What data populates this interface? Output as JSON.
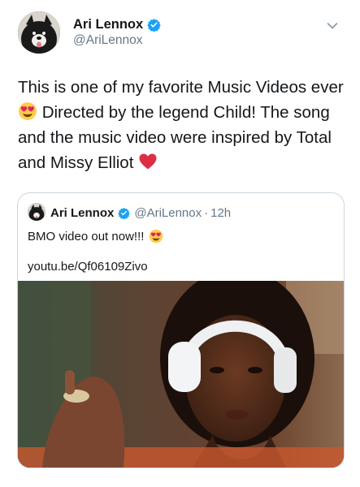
{
  "tweet": {
    "author_name": "Ari Lennox",
    "author_handle": "@AriLennox",
    "text_part1": "This is one of my favorite Music Videos ever",
    "text_part2": " Directed by the legend Child! The song and the music video were inspired by Total and Missy Elliot ",
    "emoji_1": "smiling-face-with-heart-eyes",
    "emoji_2": "red-heart"
  },
  "quoted": {
    "author_name": "Ari Lennox",
    "author_handle": "@AriLennox",
    "separator": "·",
    "time": "12h",
    "text": "BMO video out now!!!",
    "emoji": "smiling-face-with-heart-eyes",
    "link": "youtu.be/Qf06109Zivo"
  },
  "colors": {
    "verified": "#1da1f2",
    "secondary_text": "#657786",
    "border": "#ccd6dd",
    "heart": "#e0245e"
  }
}
